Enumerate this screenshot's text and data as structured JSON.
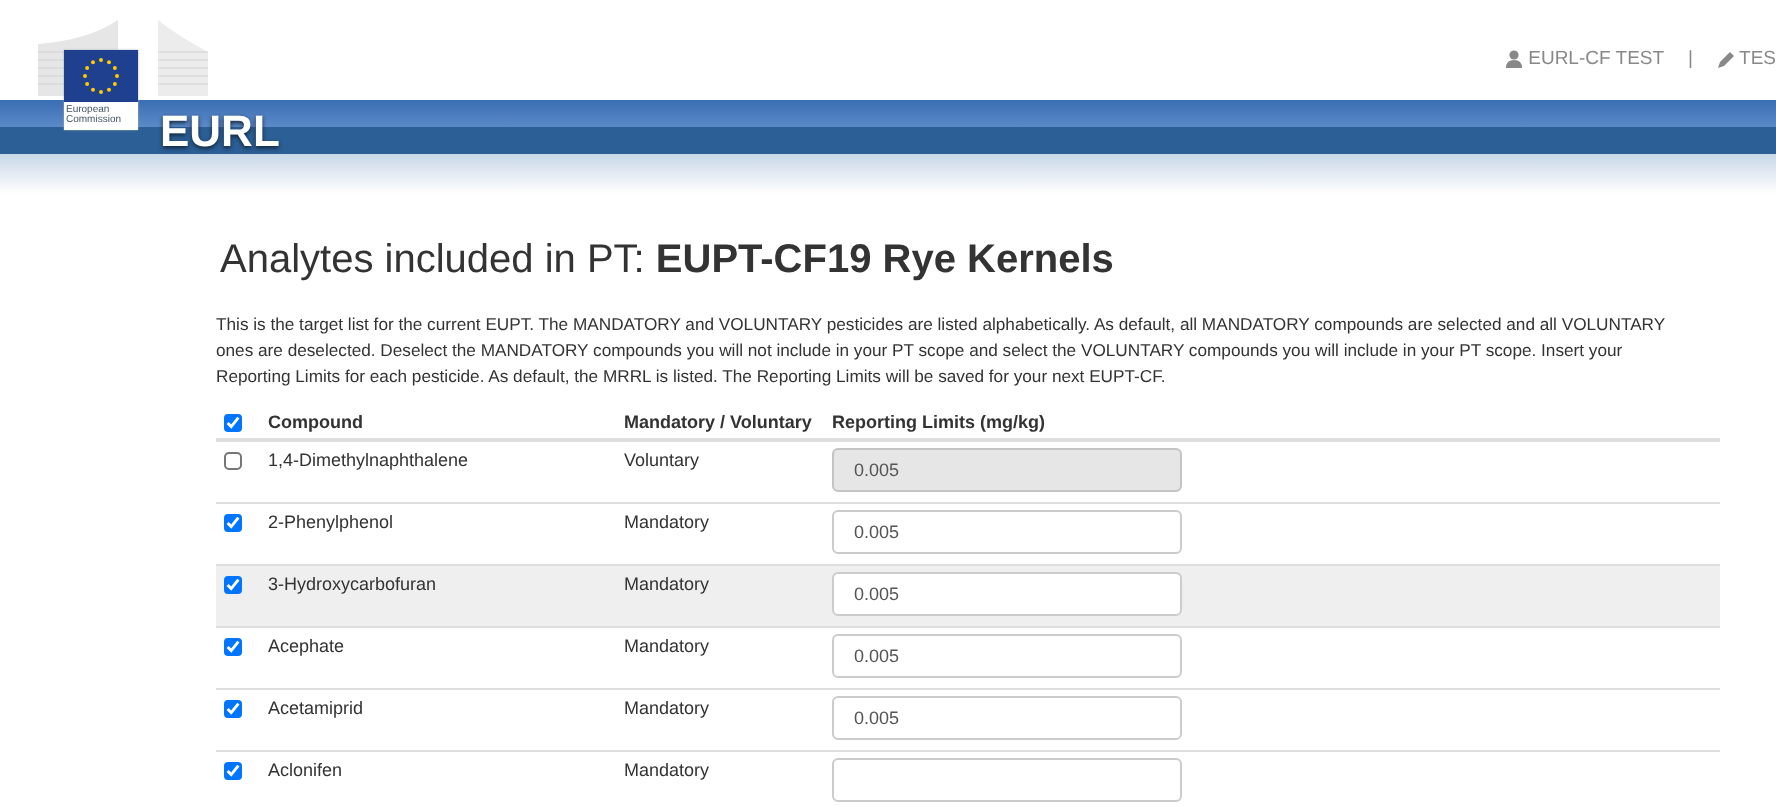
{
  "header": {
    "logo_caption": "European Commission",
    "site_name": "EURL",
    "user": "EURL-CF TEST",
    "separator": "|",
    "second_link": "TES"
  },
  "title": {
    "prefix": "Analytes included in PT: ",
    "name": "EUPT-CF19 Rye Kernels"
  },
  "intro": "This is the target list for the current EUPT. The MANDATORY and VOLUNTARY pesticides are listed alphabetically. As default, all MANDATORY compounds are selected and all VOLUNTARY ones are deselected. Deselect the MANDATORY compounds you will not include in your PT scope and select the VOLUNTARY compounds you will include in your PT scope. Insert your Reporting Limits for each pesticide. As default, the MRRL is listed. The Reporting Limits will be saved for your next EUPT-CF.",
  "table": {
    "select_all_checked": true,
    "columns": [
      "Compound",
      "Mandatory / Voluntary",
      "Reporting Limits (mg/kg)"
    ],
    "rows": [
      {
        "checked": false,
        "compound": "1,4-Dimethylnaphthalene",
        "type": "Voluntary",
        "limit": "0.005",
        "disabled": true,
        "hovered": false
      },
      {
        "checked": true,
        "compound": "2-Phenylphenol",
        "type": "Mandatory",
        "limit": "0.005",
        "disabled": false,
        "hovered": false
      },
      {
        "checked": true,
        "compound": "3-Hydroxycarbofuran",
        "type": "Mandatory",
        "limit": "0.005",
        "disabled": false,
        "hovered": true
      },
      {
        "checked": true,
        "compound": "Acephate",
        "type": "Mandatory",
        "limit": "0.005",
        "disabled": false,
        "hovered": false
      },
      {
        "checked": true,
        "compound": "Acetamiprid",
        "type": "Mandatory",
        "limit": "0.005",
        "disabled": false,
        "hovered": false
      },
      {
        "checked": true,
        "compound": "Aclonifen",
        "type": "Mandatory",
        "disabled": false,
        "hovered": false
      }
    ]
  }
}
